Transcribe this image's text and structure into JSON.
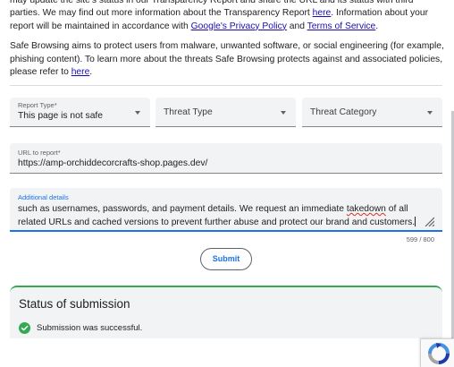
{
  "intro": {
    "para1_line1": "may update the site's status in our Transparency Report and share the URL and its status with third parties. We",
    "para1_pre": "may find out more information about the Transparency Report ",
    "para1_link_here": "here",
    "para1_mid": ". Information about your report will be maintained in accordance with ",
    "para1_link_privacy": "Google's Privacy Policy",
    "para1_and": " and ",
    "para1_link_terms": "Terms of Service",
    "para1_end": ".",
    "para2_text": "Safe Browsing aims to protect users from malware, unwanted software, or social engineering (for example, phishing content). To learn more about the threats Safe Browsing protects against and associated policies, please refer to ",
    "para2_link": "here",
    "para2_end": "."
  },
  "form": {
    "report_type": {
      "label": "Report Type*",
      "value": "This page is not safe"
    },
    "threat_type": {
      "placeholder": "Threat Type"
    },
    "threat_category": {
      "placeholder": "Threat Category"
    },
    "url": {
      "label": "URL to report*",
      "value": "https://amp-orchiddecorcrafts-shop.pages.dev/"
    },
    "details": {
      "label": "Additional details",
      "text_before_typo": "such as usernames, passwords, and payment details. We request an immediate ",
      "typo_word": "takedown",
      "text_after_typo": " of all related URLs and cached versions to prevent further abuse and protect our brand and customers."
    },
    "char_counter": "599 / 800",
    "submit_label": "Submit"
  },
  "status": {
    "title": "Status of submission",
    "message": "Submission was successful."
  },
  "colors": {
    "link": "#1a0dab",
    "accent": "#1a73e8",
    "success": "#34a853",
    "field_bg": "#f1f3f4"
  }
}
